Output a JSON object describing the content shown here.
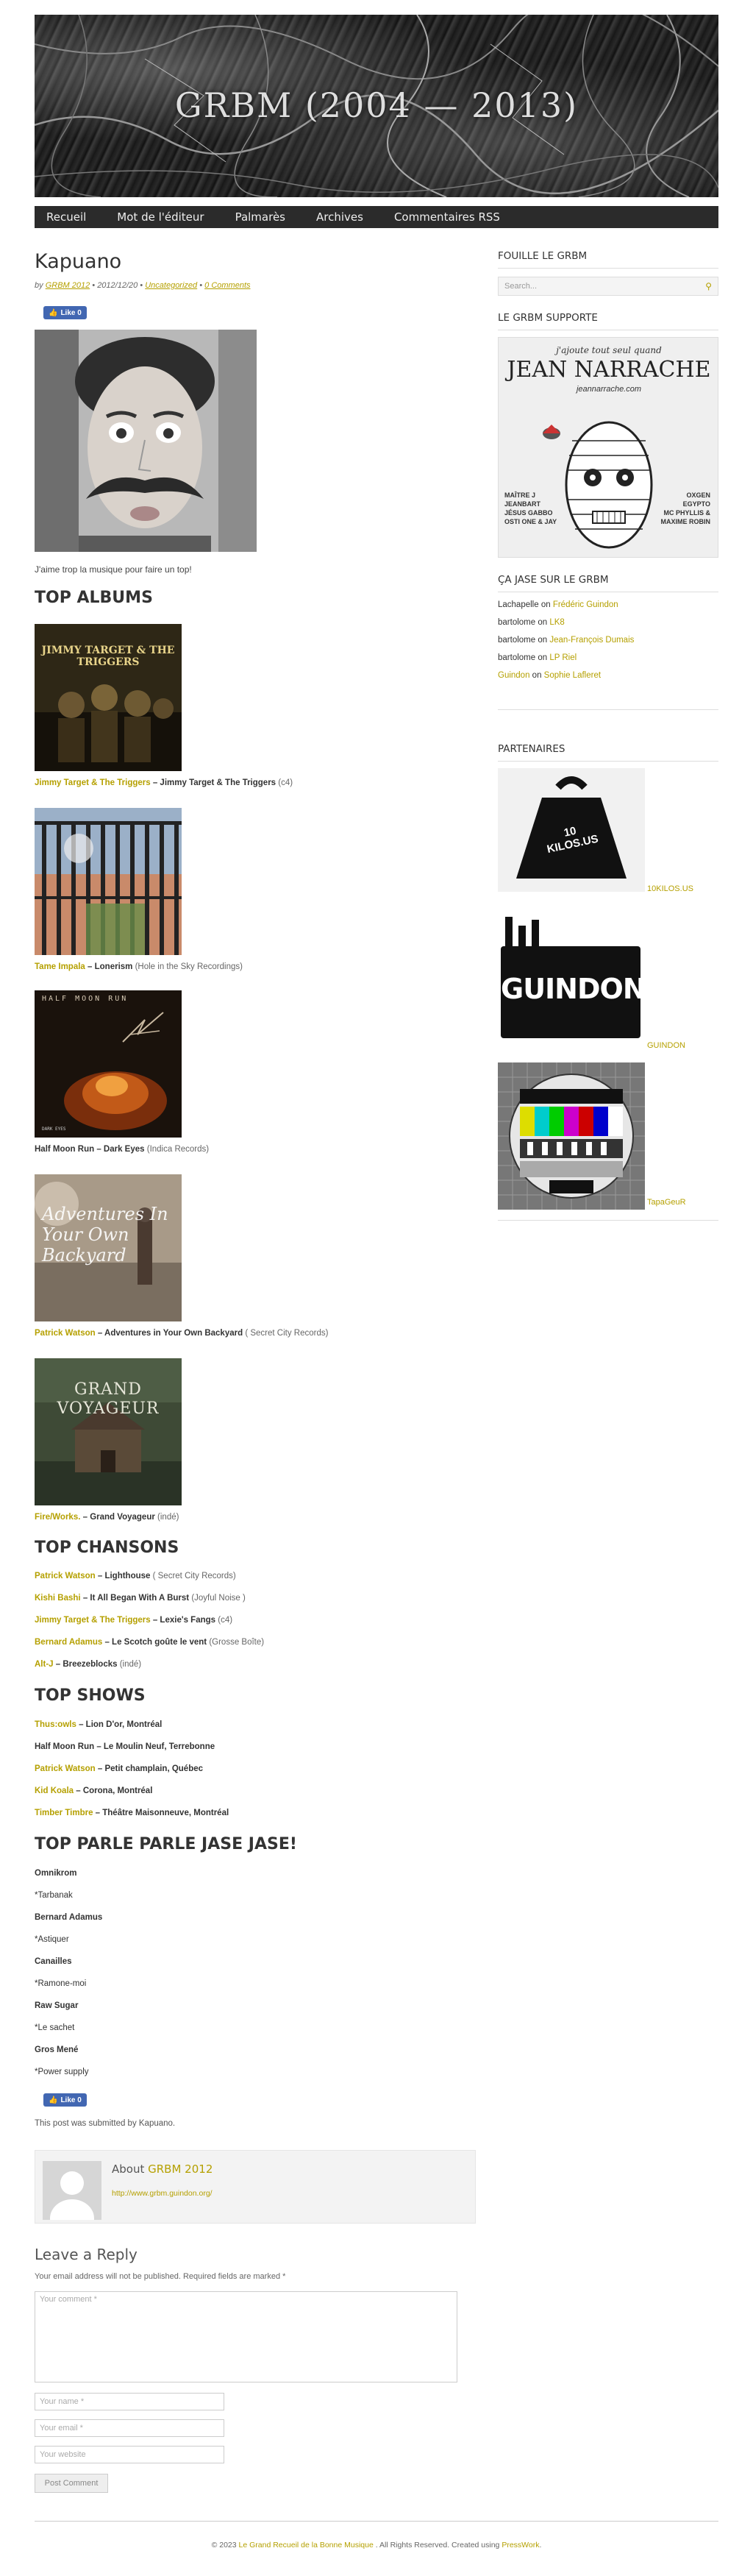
{
  "site": {
    "title": "GRBM (2004 — 2013)"
  },
  "nav": [
    "Recueil",
    "Mot de l'éditeur",
    "Palmarès",
    "Archives",
    "Commentaires RSS"
  ],
  "post": {
    "title": "Kapuano",
    "meta_by": "by",
    "author": "GRBM 2012",
    "date": "• 2012/12/20 •",
    "category": "Uncategorized",
    "comments": "0 Comments",
    "like": "Like 0",
    "caption": "J'aime trop la musique pour faire un top!",
    "top_albums_heading": "TOP ALBUMS",
    "albums": [
      {
        "artist": "Jimmy Target & The Triggers",
        "title": "– Jimmy Target & The Triggers",
        "label": " (c4)"
      },
      {
        "artist": "Tame Impala",
        "title": "– Lonerism",
        "label": " (Hole in the Sky Recordings)"
      },
      {
        "artist": "",
        "title": "Half Moon Run – Dark Eyes",
        "label": " (Indica Records)"
      },
      {
        "artist": "Patrick Watson",
        "title": "– Adventures in Your Own Backyard",
        "label": " ( Secret City Records)"
      },
      {
        "artist": "Fire/Works.",
        "title": "– Grand Voyageur",
        "label": " (indé)"
      }
    ],
    "album_cover_texts": [
      "JIMMY TARGET & THE TRIGGERS",
      "",
      "HALF MOON RUN",
      "Adventures In Your Own Backyard",
      "GRAND VOYAGEUR"
    ],
    "top_songs_heading": "TOP CHANSONS",
    "songs": [
      {
        "artist": "Patrick Watson",
        "title": "– Lighthouse",
        "label": " ( Secret City Records)"
      },
      {
        "artist": "Kishi Bashi",
        "title": "– It All Began With A Burst",
        "label": " (Joyful Noise )"
      },
      {
        "artist": "Jimmy Target & The Triggers",
        "title": "– Lexie's Fangs",
        "label": " (c4)"
      },
      {
        "artist": "Bernard Adamus",
        "title": "– Le Scotch goûte le vent",
        "label": " (Grosse Boîte)"
      },
      {
        "artist": "Alt-J",
        "title": "– Breezeblocks",
        "label": " (indé)"
      }
    ],
    "top_shows_heading": "TOP SHOWS",
    "shows": [
      {
        "artist": "Thus:owls",
        "title": "– Lion D'or, Montréal"
      },
      {
        "artist": "",
        "title": "Half Moon Run – Le Moulin Neuf, Terrebonne"
      },
      {
        "artist": "Patrick Watson",
        "title": "– Petit champlain, Québec"
      },
      {
        "artist": "Kid Koala",
        "title": "– Corona, Montréal"
      },
      {
        "artist": "Timber Timbre",
        "title": "– Théâtre Maisonneuve, Montréal"
      }
    ],
    "jase_heading": "TOP PARLE PARLE JASE JASE!",
    "jase": [
      {
        "artist": "Omnikrom",
        "song": "*Tarbanak"
      },
      {
        "artist": "Bernard Adamus",
        "song": "*Astiquer"
      },
      {
        "artist": "Canailles",
        "song": "*Ramone-moi"
      },
      {
        "artist": "Raw Sugar",
        "song": "*Le sachet"
      },
      {
        "artist": "Gros Mené",
        "song": "*Power supply"
      }
    ],
    "like2": "Like 0",
    "submitted": "This post was submitted by Kapuano."
  },
  "author_box": {
    "about": "About",
    "name": "GRBM 2012",
    "url": "http://www.grbm.guindon.org/"
  },
  "reply": {
    "heading": "Leave a Reply",
    "note": "Your email address will not be published. Required fields are marked *",
    "comment_placeholder": "Your comment *",
    "name_placeholder": "Your name *",
    "email_placeholder": "Your email *",
    "website_placeholder": "Your website",
    "submit": "Post Comment"
  },
  "sidebar": {
    "search_heading": "FOUILLE LE GRBM",
    "search_placeholder": "Search...",
    "supports_heading": "LE GRBM SUPPORTE",
    "poster": {
      "line1": "j'ajoute tout seul quand",
      "line2": "JEAN NARRACHE",
      "line3": "jeannarrache.com",
      "left": [
        "MAÎTRE J",
        "JEANBART",
        "JÉSUS GABBO",
        "OSTI ONE & JAY"
      ],
      "right": [
        "OXGEN",
        "EGYPTO",
        "MC PHYLLIS &",
        "MAXIME ROBIN"
      ]
    },
    "comments_heading": "ÇA JASE SUR LE GRBM",
    "recent": [
      {
        "who": "Lachapelle",
        "who_link": false,
        "on": " on ",
        "post": "Frédéric Guindon"
      },
      {
        "who": "bartolome",
        "who_link": false,
        "on": " on ",
        "post": "LK8"
      },
      {
        "who": "bartolome",
        "who_link": false,
        "on": " on ",
        "post": "Jean-François Dumais"
      },
      {
        "who": "bartolome",
        "who_link": false,
        "on": " on ",
        "post": "LP Riel"
      },
      {
        "who": "Guindon",
        "who_link": true,
        "on": " on ",
        "post": "Sophie Lafleret"
      }
    ],
    "partners_heading": "PARTENAIRES",
    "partners": [
      {
        "label": "10KILOS.US",
        "logo": "10 KILOS.US"
      },
      {
        "label": "GUINDON",
        "logo": "GUINDON"
      },
      {
        "label": "TapaGeuR",
        "logo": ""
      }
    ]
  },
  "footer": {
    "prefix": "© 2023 ",
    "site_link": "Le Grand Recueil de la Bonne Musique",
    "middle": " . All Rights Reserved. Created using ",
    "theme_link": "PressWork",
    "suffix": "."
  }
}
